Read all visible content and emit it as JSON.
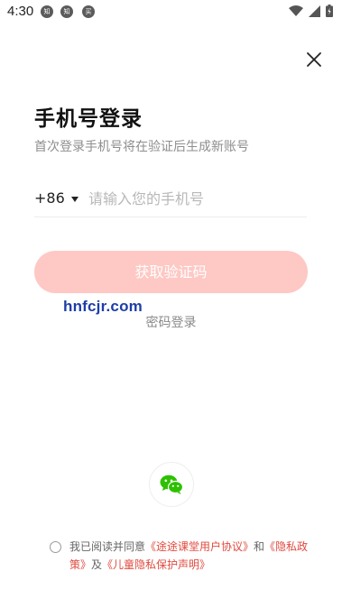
{
  "status_bar": {
    "time": "4:30",
    "notifications": [
      "知",
      "知",
      "买"
    ]
  },
  "login": {
    "title": "手机号登录",
    "subtitle": "首次登录手机号将在验证后生成新账号",
    "country_code": "+86",
    "phone_placeholder": "请输入您的手机号",
    "get_code_label": "获取验证码",
    "password_login_label": "密码登录"
  },
  "watermark": "hnfcjr.com",
  "agreement": {
    "prefix": "我已阅读并同意",
    "user_agreement": "《途途课堂用户协议》",
    "and": "和",
    "privacy_policy": "《隐私政策》",
    "and2": "及",
    "child_privacy": "《儿童隐私保护声明》"
  },
  "colors": {
    "accent_light": "#fec8c4",
    "link": "#e04a3f",
    "wechat": "#2dc100"
  },
  "icons": {
    "close": "close-icon",
    "wechat": "wechat-icon"
  }
}
